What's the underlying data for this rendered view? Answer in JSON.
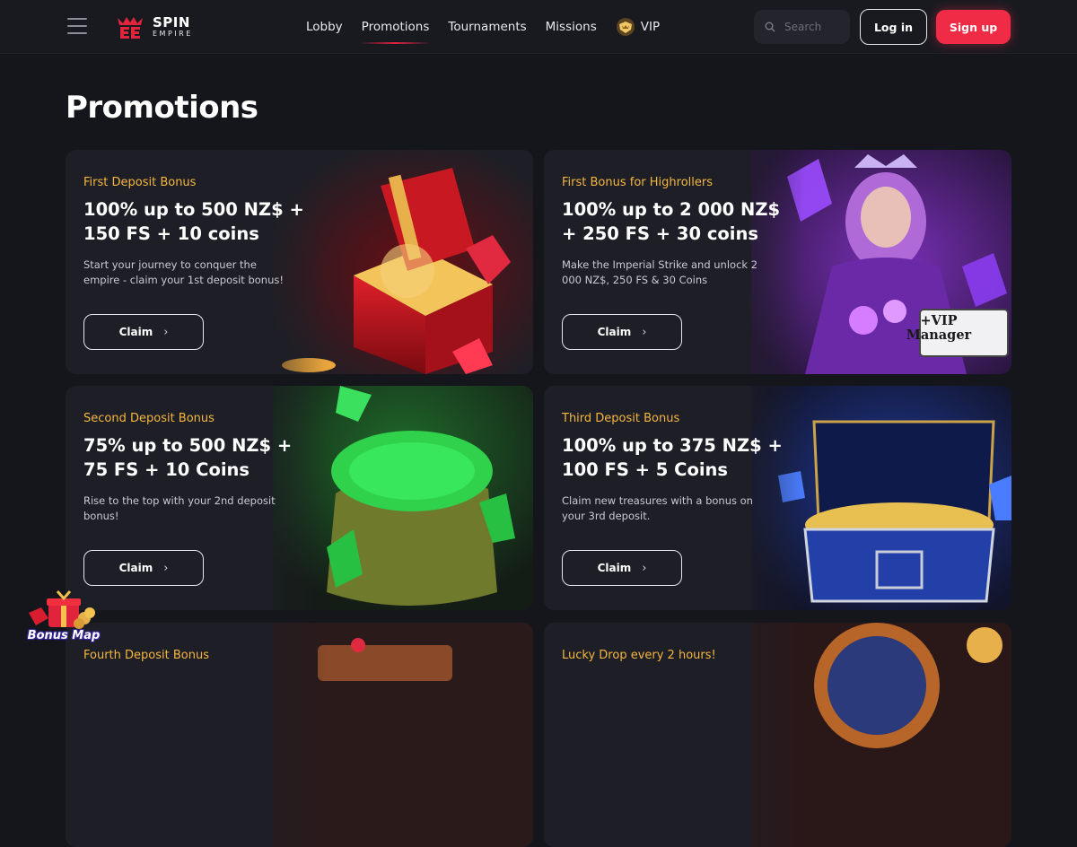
{
  "header": {
    "logo": {
      "line1": "SPIN",
      "line2": "EMPIRE"
    },
    "nav": [
      {
        "label": "Lobby",
        "active": false
      },
      {
        "label": "Promotions",
        "active": true
      },
      {
        "label": "Tournaments",
        "active": false
      },
      {
        "label": "Missions",
        "active": false
      },
      {
        "label": "VIP",
        "active": false
      }
    ],
    "search_placeholder": "Search",
    "login_label": "Log in",
    "signup_label": "Sign up"
  },
  "page_title": "Promotions",
  "promotions": [
    {
      "title": "First Deposit Bonus",
      "headline": "100% up to 500 NZ$ + 150 FS + 10 coins",
      "description": "Start your journey to conquer the empire - claim your 1st deposit bonus!",
      "cta": "Claim"
    },
    {
      "title": "First Bonus for Highrollers",
      "headline": "100% up to 2 000 NZ$ + 250 FS + 30 coins",
      "description": "Make the Imperial Strike and unlock 2 000 NZ$, 250 FS & 30 Coins",
      "cta": "Claim",
      "badge": "+VIP Manager"
    },
    {
      "title": "Second Deposit Bonus",
      "headline": "75% up to 500 NZ$ + 75 FS + 10 Coins",
      "description": "Rise to the top with your 2nd deposit bonus!",
      "cta": "Claim"
    },
    {
      "title": "Third Deposit Bonus",
      "headline": "100% up to 375 NZ$ + 100 FS + 5 Coins",
      "description": "Claim new treasures with a bonus on your 3rd deposit.",
      "cta": "Claim"
    },
    {
      "title": "Fourth Deposit Bonus"
    },
    {
      "title": "Lucky Drop every 2 hours!"
    }
  ],
  "bonus_map_label": "Bonus Map",
  "colors": {
    "accent": "#ef2b46",
    "promo_title": "#f5b63f",
    "card_bg": "#1e1f26",
    "page_bg": "#15161c"
  }
}
